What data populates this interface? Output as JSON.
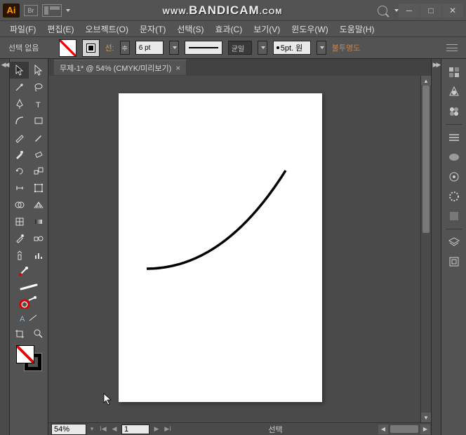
{
  "titlebar": {
    "app_abbr": "Ai",
    "br_label": "Br",
    "watermark_prefix": "WWW.",
    "watermark_main": "BANDICAM",
    "watermark_suffix": ".COM"
  },
  "menu": {
    "file": "파일(F)",
    "edit": "편집(E)",
    "object": "오브젝트(O)",
    "type": "문자(T)",
    "select": "선택(S)",
    "effect": "효과(C)",
    "view": "보기(V)",
    "window": "윈도우(W)",
    "help": "도움말(H)"
  },
  "controlbar": {
    "selection_label": "선택 없음",
    "stroke_label": "선:",
    "stroke_weight": "6 pt",
    "stroke_style_label": "균일",
    "dash_label": "5pt. 원",
    "opacity_label": "불투명도"
  },
  "document": {
    "tab_title": "무제-1* @ 54% (CMYK/미리보기)"
  },
  "status": {
    "zoom": "54%",
    "page": "1",
    "mode": "선택"
  },
  "colors": {
    "accent": "#ff9a00",
    "bg": "#535353",
    "artboard": "#ffffff"
  }
}
